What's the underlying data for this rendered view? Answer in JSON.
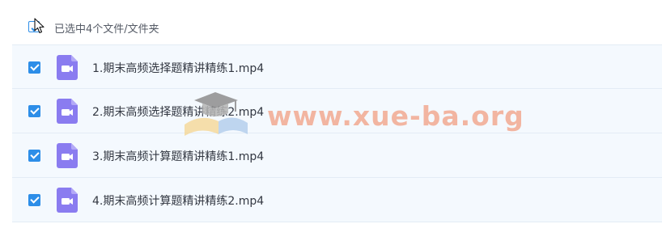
{
  "header": {
    "selection_label": "已选中4个文件/文件夹"
  },
  "files": [
    {
      "name": "1.期末高频选择题精讲精练1.mp4",
      "checked": true,
      "icon": "video-file-icon"
    },
    {
      "name": "2.期末高频选择题精讲精练2.mp4",
      "checked": true,
      "icon": "video-file-icon"
    },
    {
      "name": "3.期末高频计算题精讲精练1.mp4",
      "checked": true,
      "icon": "video-file-icon"
    },
    {
      "name": "4.期末高频计算题精讲精练2.mp4",
      "checked": true,
      "icon": "video-file-icon"
    }
  ],
  "watermark": {
    "text": "www.xue-ba.org"
  },
  "colors": {
    "accent": "#2d8ee8",
    "row_background": "#f4f9fe",
    "file_icon": "#8a7cf0",
    "watermark": "#f2a58a"
  }
}
